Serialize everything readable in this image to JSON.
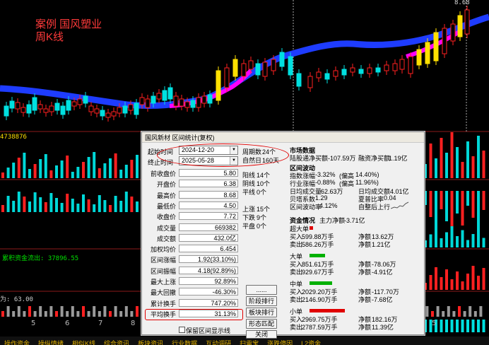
{
  "overlay": {
    "line1": "案例 国风塑业",
    "line2": "周K线"
  },
  "chart": {
    "price_top_label": "8.68",
    "vol_label": "4738876",
    "fund_label": "累积资金流出: 37896.55",
    "low_label": "为: 63.00",
    "x_ticks": [
      "5",
      "6",
      "7",
      "8",
      "3",
      "4",
      "5"
    ]
  },
  "tabs": [
    "操作资金",
    "操纵情绪",
    "相似K线",
    "综合资讯",
    "板块资讯",
    "行业数据",
    "互动调研",
    "扫雷宝",
    "涨跌停因",
    "L2资金"
  ],
  "dialog": {
    "title": "国风新材 区间统计(复权)",
    "start_label": "起始时间",
    "start_date": "2024-12-20",
    "end_label": "终止时间",
    "end_date": "2025-05-28",
    "period_label": "周期数",
    "period_value": "24个",
    "natural_label": "自然日",
    "natural_value": "160天",
    "stats": [
      {
        "label": "前收盘价",
        "value": "5.80"
      },
      {
        "label": "开盘价",
        "value": "6.38"
      },
      {
        "label": "最高价",
        "value": "8.68"
      },
      {
        "label": "最低价",
        "value": "4.50"
      },
      {
        "label": "收盘价",
        "value": "7.72"
      },
      {
        "label": "成交量",
        "value": "669382"
      },
      {
        "label": "成交额",
        "value": "432.0亿"
      },
      {
        "label": "加权均价",
        "value": "6.454"
      },
      {
        "label": "区间涨幅",
        "value": "1.92(33.10%)"
      },
      {
        "label": "区间振幅",
        "value": "4.18(92.89%)"
      },
      {
        "label": "最大上涨",
        "value": "92.89%"
      },
      {
        "label": "最大回撤",
        "value": "-46.30%"
      },
      {
        "label": "累计换手",
        "value": "747.20%"
      },
      {
        "label": "平均换手",
        "value": "31.13%"
      }
    ],
    "counts1": [
      {
        "label": "阳线",
        "value": "14个"
      },
      {
        "label": "阴线",
        "value": "10个"
      },
      {
        "label": "平线",
        "value": "0个"
      }
    ],
    "counts2": [
      {
        "label": "上涨",
        "value": "15个"
      },
      {
        "label": "下跌",
        "value": "9个"
      },
      {
        "label": "平盘",
        "value": "0个"
      }
    ],
    "buttons": {
      "more": "......",
      "rank": "阶段排行",
      "sector_rank": "板块排行",
      "pattern": "形态匹配",
      "close": "关闭"
    },
    "checkbox_label": "保留区间显示线",
    "market": {
      "header": "市场数据",
      "lgt_label": "陆股通净买额",
      "lgt_value": "-107.59万",
      "margin_label": "融资净买额",
      "margin_value": "1.19亿"
    },
    "range": {
      "header": "区间波动",
      "index_label": "指数涨幅",
      "index_value": "-3.32%",
      "index_dev_label": "(偏高",
      "index_dev": "14.40%)",
      "industry_label": "行业涨幅",
      "industry_value": "-0.88%",
      "industry_dev_label": "(偏高",
      "industry_dev": "11.96%)",
      "day_vol_label": "日均成交量",
      "day_vol": "62.63万",
      "day_amt_label": "日均成交额",
      "day_amt": "4.01亿",
      "beta_label": "贝塔系数",
      "beta": "1.29",
      "sharpe_label": "夏普比率",
      "sharpe": "0.04",
      "volatility_label": "区间波动率",
      "volatility": "4.12%",
      "trend_label": "自整后上行"
    },
    "funds": {
      "header": "资金情况",
      "main_label": "主力净额",
      "main_value": "-3.71亿",
      "groups": [
        {
          "name": "超大单",
          "buy_label": "买入",
          "buy": "599.88万手",
          "sell_label": "卖出",
          "sell": "586.26万手",
          "net_label": "净额",
          "net1": "13.62万",
          "net2": "1.21亿"
        },
        {
          "name": "大单",
          "buy_label": "买入",
          "buy": "851.61万手",
          "sell_label": "卖出",
          "sell": "929.67万手",
          "net_label": "净额",
          "net1": "-78.06万",
          "net2": "-4.91亿"
        },
        {
          "name": "中单",
          "buy_label": "买入",
          "buy": "2029.20万手",
          "sell_label": "卖出",
          "sell": "2146.90万手",
          "net_label": "净额",
          "net1": "-117.70万",
          "net2": "-7.68亿"
        },
        {
          "name": "小单",
          "buy_label": "买入",
          "buy": "2969.75万手",
          "sell_label": "卖出",
          "sell": "2787.59万手",
          "net_label": "净额",
          "net1": "182.16万",
          "net2": "11.39亿"
        }
      ]
    }
  }
}
